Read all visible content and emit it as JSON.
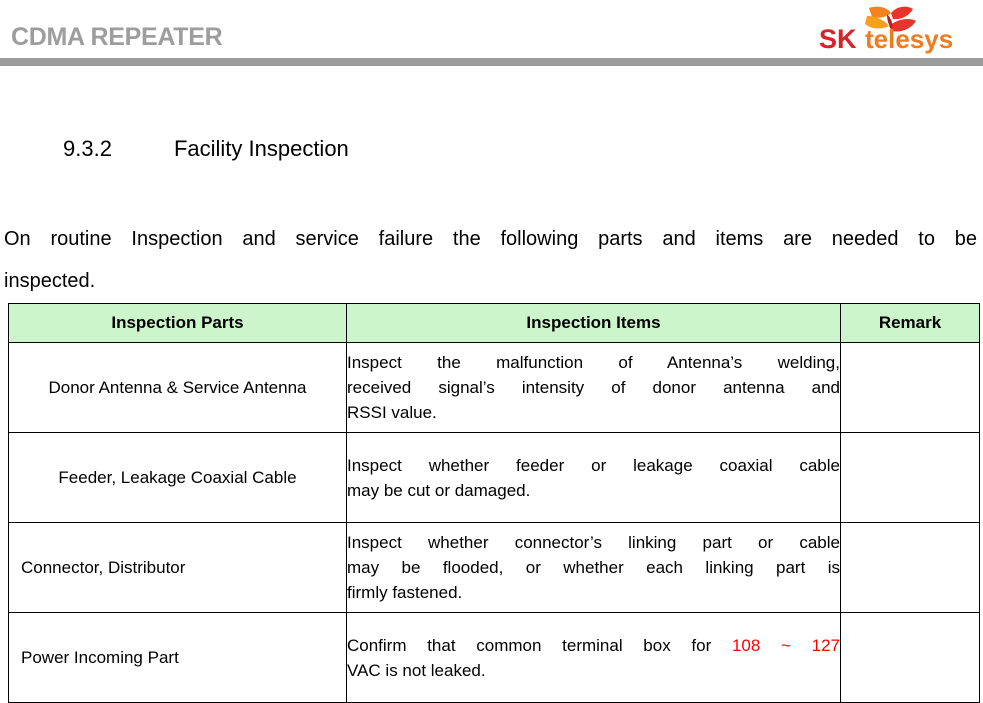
{
  "header": {
    "title": "CDMA REPEATER",
    "logo": {
      "name": "sk-telesys-logo",
      "mark_text": "SK",
      "word_text": "telesys",
      "mark_color": "#D8232A",
      "word_color": "#F07C22",
      "butterfly_colors": [
        "#F58220",
        "#E8342C",
        "#F9A01B"
      ]
    },
    "rule_color": "#9c9c9c",
    "title_color": "#9d9d9d"
  },
  "section": {
    "number": "9.3.2",
    "title": "Facility Inspection"
  },
  "intro": {
    "line1": "On routine Inspection and service failure the following parts and items are needed to be",
    "line2": "inspected."
  },
  "table": {
    "header_bg": "#ccf5cc",
    "columns": [
      {
        "key": "parts",
        "label": "Inspection Parts"
      },
      {
        "key": "items",
        "label": "Inspection Items"
      },
      {
        "key": "remark",
        "label": "Remark"
      }
    ],
    "rows": [
      {
        "parts": "Donor Antenna & Service Antenna",
        "parts_align": "center",
        "items_lines": [
          {
            "text": "Inspect the malfunction of Antenna’s welding,",
            "justify": true
          },
          {
            "text": "received signal’s intensity of donor antenna and",
            "justify": true
          },
          {
            "text": "RSSI value.",
            "justify": false
          }
        ],
        "remark": ""
      },
      {
        "parts": "Feeder, Leakage Coaxial Cable",
        "parts_align": "center",
        "items_lines": [
          {
            "text": "Inspect whether feeder or leakage coaxial cable",
            "justify": true
          },
          {
            "text": "may be cut or damaged.",
            "justify": false
          }
        ],
        "remark": ""
      },
      {
        "parts": "Connector, Distributor",
        "parts_align": "left",
        "items_lines": [
          {
            "text": "Inspect whether connector’s linking part or cable",
            "justify": true
          },
          {
            "text": "may be flooded, or whether each linking part is",
            "justify": true
          },
          {
            "text": "firmly fastened.",
            "justify": false
          }
        ],
        "remark": ""
      },
      {
        "parts": "Power Incoming Part",
        "parts_align": "left",
        "items_lines": [
          {
            "text": "Confirm that common terminal box for ",
            "justify": true,
            "highlight": "108 ~ 127",
            "highlight_color": "#ff0000"
          },
          {
            "text": "VAC is not leaked.",
            "justify": false
          }
        ],
        "remark": ""
      }
    ]
  }
}
